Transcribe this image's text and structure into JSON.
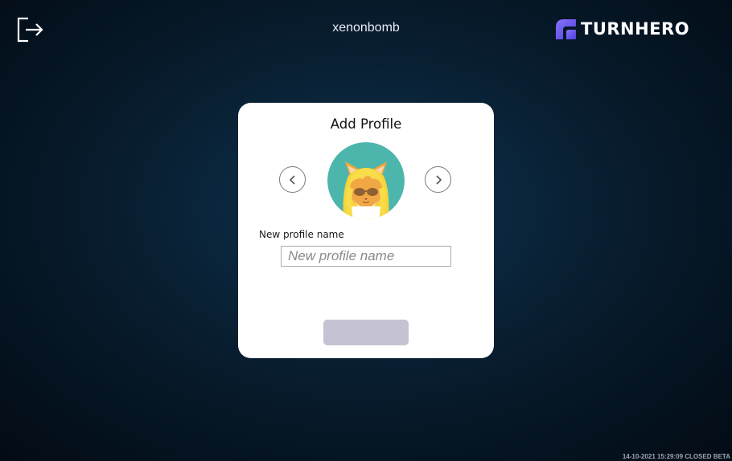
{
  "header": {
    "logout_icon": "logout-icon",
    "username": "xenonbomb",
    "brand": {
      "name": "TURNHERO",
      "logo_icon": "turnhero-logo-icon",
      "logo_color": "#6f5cf0"
    }
  },
  "dialog": {
    "title": "Add Profile",
    "prev_icon": "chevron-left-icon",
    "next_icon": "chevron-right-icon",
    "avatar": {
      "icon": "cat-avatar-icon",
      "background_color": "#4db6ac"
    },
    "name_field": {
      "label": "New profile name",
      "placeholder": "New profile name",
      "value": ""
    },
    "submit_button": {
      "label": "",
      "disabled": true,
      "color": "#c5c3d3"
    }
  },
  "footer": {
    "stamp": "14-10-2021 15:29:09 CLOSED BETA"
  },
  "theme": {
    "background": "#0a2338",
    "card": "#ffffff"
  }
}
